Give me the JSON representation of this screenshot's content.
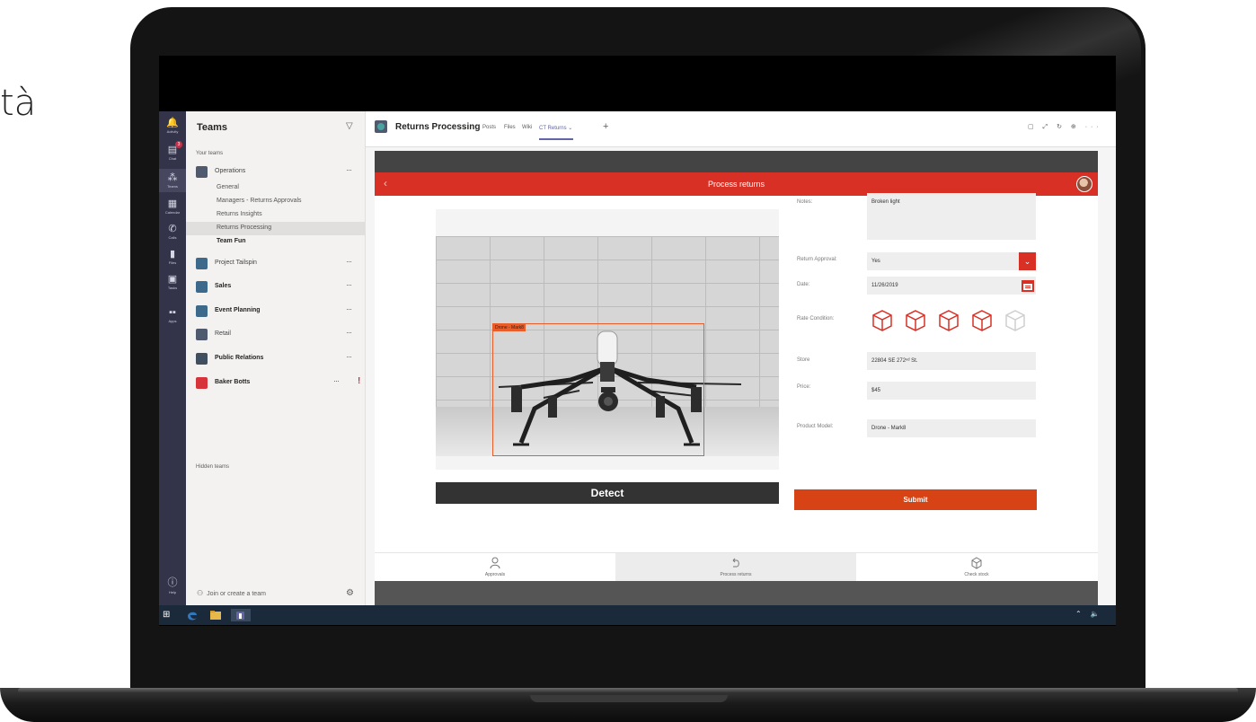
{
  "side_text": "tà",
  "appbar": {
    "items": [
      {
        "label": "Activity",
        "icon": "bell-icon"
      },
      {
        "label": "Chat",
        "icon": "chat-icon",
        "badge": "3"
      },
      {
        "label": "Teams",
        "icon": "teams-icon"
      },
      {
        "label": "Calendar",
        "icon": "calendar-icon"
      },
      {
        "label": "Calls",
        "icon": "phone-icon"
      },
      {
        "label": "Files",
        "icon": "file-icon"
      },
      {
        "label": "Tasks",
        "icon": "tasks-icon"
      },
      {
        "label": "Apps",
        "icon": "apps-icon"
      },
      {
        "label": "Help",
        "icon": "help-icon"
      }
    ]
  },
  "teams_panel": {
    "title": "Teams",
    "your_teams": "Your teams",
    "teams": [
      {
        "name": "Operations",
        "bold": false,
        "color": "#505a6e"
      },
      {
        "name": "Project Tailspin",
        "bold": false,
        "color": "#3d6a8a"
      },
      {
        "name": "Sales",
        "bold": true,
        "color": "#3d6a8a"
      },
      {
        "name": "Event Planning",
        "bold": true,
        "color": "#3d6a8a"
      },
      {
        "name": "Retail",
        "bold": false,
        "color": "#505a6e"
      },
      {
        "name": "Public Relations",
        "bold": true,
        "color": "#3f4f5f"
      },
      {
        "name": "Baker Botts",
        "bold": true,
        "color": "#d6333a"
      }
    ],
    "channels": [
      "General",
      "Managers - Returns Approvals",
      "Returns Insights",
      "Returns Processing",
      "Team Fun"
    ],
    "hidden_teams": "Hidden teams",
    "join": "Join or create a team"
  },
  "tabbar": {
    "title": "Returns Processing",
    "tabs": [
      "Posts",
      "Files",
      "Wiki",
      "CT Returns ⌄"
    ],
    "active_tab": "CT Returns ⌄",
    "right_icons": "▢ ⤢ ↻ ⊕ ···"
  },
  "app": {
    "header_title": "Process returns",
    "accent": "#d93025",
    "detection_label": "Drone - Mark8",
    "detect_button": "Detect",
    "form": {
      "notes_label": "Notes:",
      "notes_value": "Broken light",
      "approval_label": "Return Approval:",
      "approval_value": "Yes",
      "date_label": "Date:",
      "date_value": "11/26/2019",
      "rate_label": "Rate Condition:",
      "rating": 4,
      "rating_max": 5,
      "store_label": "Store",
      "store_value": "22804 SE 272ⁿᵈ St.",
      "price_label": "Price:",
      "price_value": "$45",
      "model_label": "Product Model:",
      "model_value": "Drone - Mark8",
      "submit_button": "Submit"
    },
    "bottom_nav": [
      {
        "label": "Approvals",
        "icon": "person-icon"
      },
      {
        "label": "Process returns",
        "icon": "return-icon"
      },
      {
        "label": "Check stock",
        "icon": "box-icon"
      }
    ],
    "bottom_nav_active": 1
  },
  "taskbar": {
    "tray": "⌃ 🔈"
  }
}
